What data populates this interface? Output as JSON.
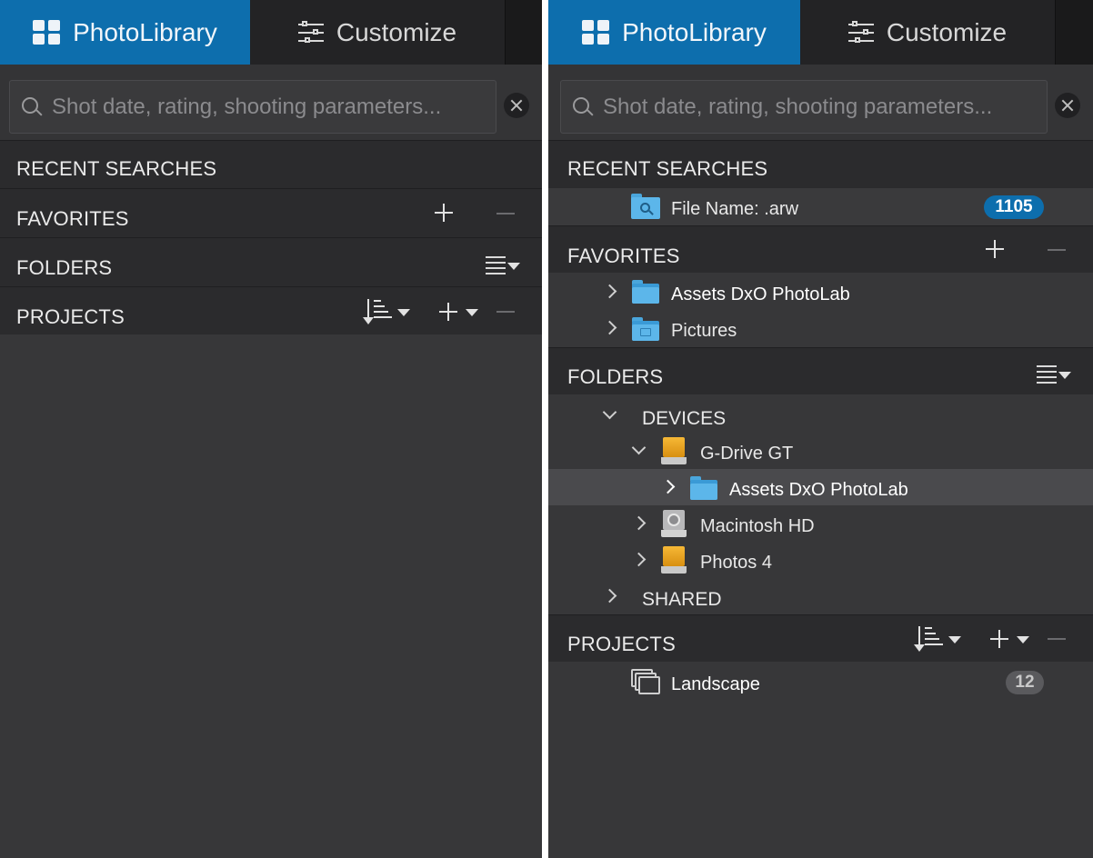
{
  "tabs": {
    "photolibrary": "PhotoLibrary",
    "customize": "Customize"
  },
  "search": {
    "placeholder": "Shot date, rating, shooting parameters..."
  },
  "sections": {
    "recent_searches": "RECENT SEARCHES",
    "favorites": "FAVORITES",
    "folders": "FOLDERS",
    "projects": "PROJECTS"
  },
  "recent_searches": [
    {
      "label": "File Name: .arw",
      "count": "1105"
    }
  ],
  "favorites": [
    {
      "label": "Assets DxO PhotoLab",
      "icon": "folder-icon"
    },
    {
      "label": "Pictures",
      "icon": "pictures-folder-icon"
    }
  ],
  "folders": {
    "devices_label": "DEVICES",
    "shared_label": "SHARED",
    "items": [
      {
        "label": "G-Drive GT",
        "icon": "external-drive-icon",
        "expanded": true
      },
      {
        "label": "Assets DxO PhotoLab",
        "icon": "folder-icon",
        "selected": true
      },
      {
        "label": "Macintosh HD",
        "icon": "hard-disk-icon",
        "expanded": false
      },
      {
        "label": "Photos 4",
        "icon": "external-drive-icon",
        "expanded": false
      }
    ]
  },
  "projects": [
    {
      "label": "Landscape",
      "count": "12"
    }
  ],
  "colors": {
    "accent": "#0d6ead",
    "panel_bg": "#373739",
    "header_bg": "#2b2b2d",
    "folder_blue": "#5cb6ea",
    "drive_orange": "#f6b836"
  }
}
